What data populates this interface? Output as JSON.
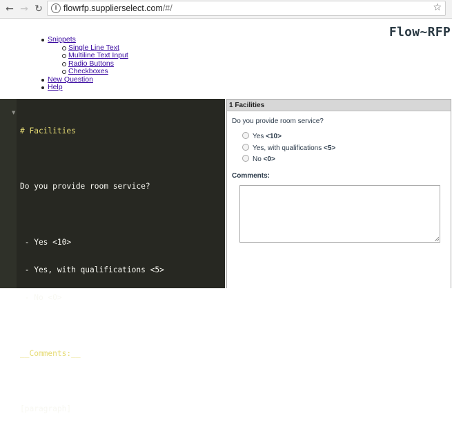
{
  "browser": {
    "url_host": "flowrfp.supplierselect.com",
    "url_path": "/#/"
  },
  "header": {
    "logo": "Flow~RFP"
  },
  "menu": {
    "snippets": "Snippets",
    "snippet_items": [
      "Single Line Text",
      "Multiline Text Input",
      "Radio Buttons",
      "Checkboxes"
    ],
    "new_question": "New Question",
    "help": "Help"
  },
  "editor": {
    "lines": [
      "# Facilities",
      "",
      "Do you provide room service?",
      "",
      " - Yes <10>",
      " - Yes, with qualifications <5>",
      " - No <0>",
      "",
      "__Comments:__",
      "",
      "[paragraph]"
    ]
  },
  "preview": {
    "section_title": "1 Facilities",
    "question": "Do you provide room service?",
    "options": [
      {
        "label": "Yes",
        "score": "<10>"
      },
      {
        "label": "Yes, with qualifications",
        "score": "<5>"
      },
      {
        "label": "No",
        "score": "<0>"
      }
    ],
    "comments_label": "Comments:"
  }
}
